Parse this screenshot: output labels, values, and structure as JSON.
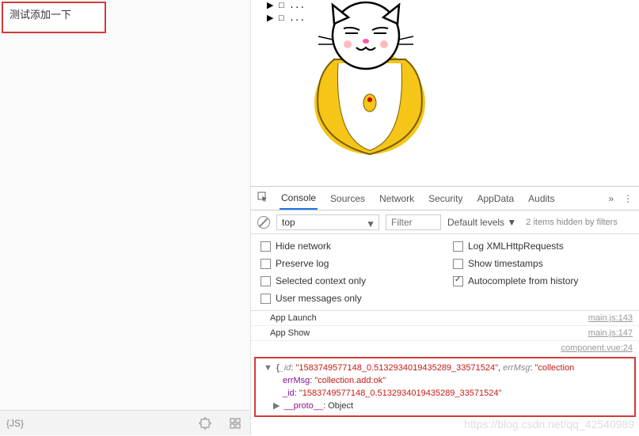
{
  "leftPanel": {
    "highlightedText": "测试添加一下",
    "bottomIcons": {
      "js": "{JS}",
      "puzzle": "puzzle",
      "grid": "grid"
    }
  },
  "preview": {
    "treeLines": [
      "▶ □ ...",
      "▶ □ ..."
    ]
  },
  "devtools": {
    "tabs": [
      "Console",
      "Sources",
      "Network",
      "Security",
      "AppData",
      "Audits"
    ],
    "activeTab": "Console",
    "filterBar": {
      "contextSelect": "top",
      "filterPlaceholder": "Filter",
      "levelsLabel": "Default levels",
      "hiddenMsg": "2 items hidden by filters"
    },
    "settings": [
      {
        "label": "Hide network",
        "checked": false
      },
      {
        "label": "Log XMLHttpRequests",
        "checked": false
      },
      {
        "label": "Preserve log",
        "checked": false
      },
      {
        "label": "Show timestamps",
        "checked": false
      },
      {
        "label": "Selected context only",
        "checked": false
      },
      {
        "label": "Autocomplete from history",
        "checked": true
      },
      {
        "label": "User messages only",
        "checked": false
      }
    ],
    "logs": [
      {
        "text": "App Launch",
        "src": "main.js:143"
      },
      {
        "text": "App Show",
        "src": "main.js:147"
      },
      {
        "text": "",
        "src": "component.vue:24"
      }
    ],
    "expandedObject": {
      "summary_id": "1583749577148_0.5132934019435289_33571524",
      "summary_errMsg": "collection",
      "errMsg": "collection.add:ok",
      "_id": "1583749577148_0.5132934019435289_33571524",
      "proto": "Object"
    }
  },
  "watermark": "https://blog.csdn.net/qq_42540989"
}
